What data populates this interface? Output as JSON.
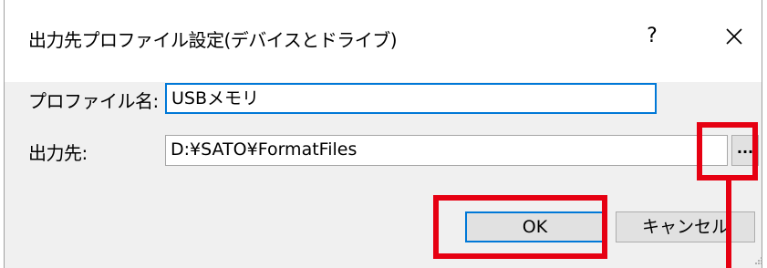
{
  "window": {
    "title": "出力先プロファイル設定(デバイスとドライブ)",
    "help_label": "?"
  },
  "form": {
    "profile_label": "プロファイル名:",
    "profile_value": "USBメモリ",
    "dest_label": "出力先:",
    "dest_value": "D:¥SATO¥FormatFiles",
    "browse_label": "..."
  },
  "buttons": {
    "ok": "OK",
    "cancel": "キャンセル"
  },
  "colors": {
    "highlight": "#e60012",
    "focus": "#0078d7"
  }
}
